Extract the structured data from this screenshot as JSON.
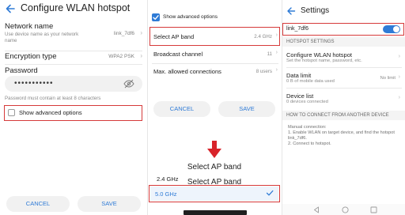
{
  "panel1": {
    "title": "Configure WLAN hotspot",
    "network_name_label": "Network name",
    "network_name_desc": "Use device name as your network name",
    "network_name_value": "link_7df6",
    "encryption_label": "Encryption type",
    "encryption_value": "WPA2 PSK",
    "password_label": "Password",
    "password_dots": "•••••••••••",
    "password_hint": "Password must contain at least 8 characters",
    "show_advanced_label": "Show advanced options",
    "show_advanced_checked": false,
    "cancel_label": "CANCEL",
    "save_label": "SAVE"
  },
  "panel2": {
    "show_advanced_label": "Show advanced options",
    "show_advanced_checked": true,
    "rows": [
      {
        "label": "Select AP band",
        "value": "2.4 GHz"
      },
      {
        "label": "Broadcast channel",
        "value": "11"
      },
      {
        "label": "Max. allowed connections",
        "value": "8 users"
      }
    ],
    "cancel_label": "CANCEL",
    "save_label": "SAVE",
    "sheet_title": "Select AP band",
    "options": [
      {
        "label": "2.4 GHz",
        "selected": false
      },
      {
        "label": "5.0 GHz",
        "selected": true
      }
    ]
  },
  "panel3": {
    "title": "Settings",
    "hotspot_name": "link_7df6",
    "hotspot_enabled": true,
    "section_settings": "HOTSPOT SETTINGS",
    "configure_title": "Configure WLAN hotspot",
    "configure_sub": "Set the hotspot name, password, etc.",
    "data_limit_title": "Data limit",
    "data_limit_sub": "0 B of mobile data used",
    "data_limit_value": "No limit",
    "device_list_title": "Device list",
    "device_list_sub": "0 devices connected",
    "section_connect": "HOW TO CONNECT FROM ANOTHER DEVICE",
    "manual_heading": "Manual connection:",
    "manual_step1": "1. Enable WLAN on target device, and find the hotspot link_7df6.",
    "manual_step2": "2. Connect to hotspot."
  },
  "colors": {
    "accent": "#2f7bd6",
    "highlight": "#d63a3a"
  }
}
